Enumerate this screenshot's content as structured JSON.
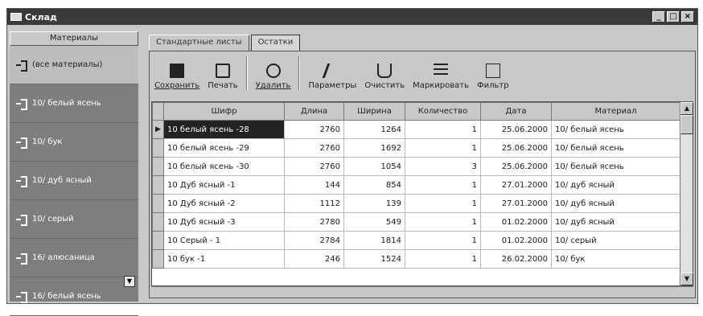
{
  "window": {
    "title": "Склад"
  },
  "sidebar": {
    "header": "Материалы",
    "items": [
      {
        "label": "(все материалы)"
      },
      {
        "label": "10/ белый ясень"
      },
      {
        "label": "10/ бук"
      },
      {
        "label": "10/ дуб ясный"
      },
      {
        "label": "10/ серый"
      },
      {
        "label": "16/ алюсаница"
      },
      {
        "label": "16/ белый ясень"
      }
    ]
  },
  "tabs": [
    {
      "label": "Стандартные листы"
    },
    {
      "label": "Остатки"
    }
  ],
  "toolbar": {
    "save": "Сохранить",
    "print": "Печать",
    "delete": "Удалить",
    "params": "Параметры",
    "clear": "Очистить",
    "mark": "Маркировать",
    "filter": "Фильтр"
  },
  "table": {
    "columns": [
      "Шифр",
      "Длина",
      "Ширина",
      "Количество",
      "Дата",
      "Материал"
    ],
    "rows": [
      [
        "10 белый ясень -28",
        "2760",
        "1264",
        "1",
        "25.06.2000",
        "10/ белый ясень"
      ],
      [
        "10 белый ясень -29",
        "2760",
        "1692",
        "1",
        "25.06.2000",
        "10/ белый ясень"
      ],
      [
        "10 белый ясень -30",
        "2760",
        "1054",
        "3",
        "25.06.2000",
        "10/ белый ясень"
      ],
      [
        "10 Дуб ясный -1",
        "144",
        "854",
        "1",
        "27.01.2000",
        "10/ дуб ясный"
      ],
      [
        "10 Дуб ясный -2",
        "1112",
        "139",
        "1",
        "27.01.2000",
        "10/ дуб ясный"
      ],
      [
        "10 Дуб ясный -3",
        "2780",
        "549",
        "1",
        "01.02.2000",
        "10/ дуб ясный"
      ],
      [
        "10 Серый - 1",
        "2784",
        "1814",
        "1",
        "01.02.2000",
        "10/ серый"
      ],
      [
        "10 бук -1",
        "246",
        "1524",
        "1",
        "26.02.2000",
        "10/ бук"
      ]
    ]
  }
}
